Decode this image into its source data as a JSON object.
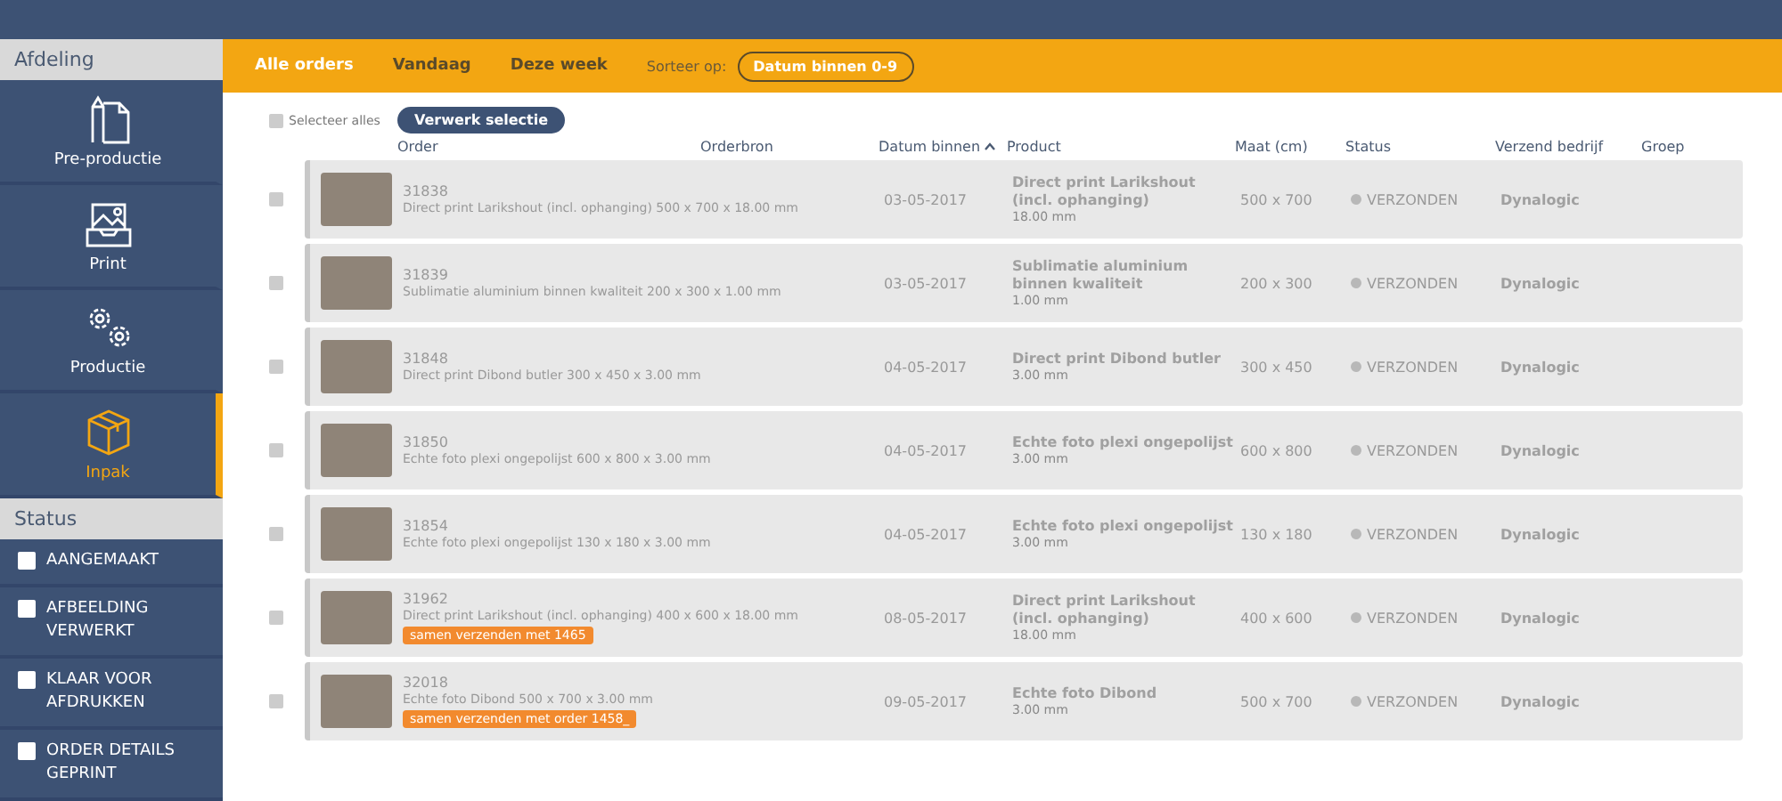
{
  "sidebar": {
    "department_heading": "Afdeling",
    "departments": [
      {
        "label": "Pre-productie",
        "kind": "document",
        "selected": false
      },
      {
        "label": "Print",
        "kind": "image",
        "selected": false
      },
      {
        "label": "Productie",
        "kind": "gears",
        "selected": false
      },
      {
        "label": "Inpak",
        "kind": "box",
        "selected": true
      }
    ],
    "status_heading": "Status",
    "statuses": [
      {
        "label": "AANGEMAAKT",
        "checked": false
      },
      {
        "label": "AFBEELDING VERWERKT",
        "checked": false
      },
      {
        "label": "KLAAR VOOR AFDRUKKEN",
        "checked": false
      },
      {
        "label": "ORDER DETAILS GEPRINT",
        "checked": false
      }
    ]
  },
  "filters": [
    {
      "label": "Alle orders",
      "selected": true
    },
    {
      "label": "Vandaag",
      "selected": false
    },
    {
      "label": "Deze week",
      "selected": false
    }
  ],
  "sort": {
    "label": "Sorteer op:",
    "value": "Datum binnen 0-9"
  },
  "toolbar": {
    "select_all": {
      "label": "Selecteer alles",
      "checked": false
    },
    "process_button": "Verwerk selectie"
  },
  "columns": [
    {
      "label": "Order",
      "sorted": false
    },
    {
      "label": "Orderbron",
      "sorted": false
    },
    {
      "label": "Datum binnen",
      "sorted": true
    },
    {
      "label": "Product",
      "sorted": false
    },
    {
      "label": "Maat (cm)",
      "sorted": false
    },
    {
      "label": "Status",
      "sorted": false
    },
    {
      "label": "Verzend bedrijf",
      "sorted": false
    },
    {
      "label": "Groep",
      "sorted": false
    }
  ],
  "rows": [
    {
      "checked": false,
      "order": "31838",
      "description": "Direct print Larikshout (incl. ophanging) 500 x 700 x 18.00 mm",
      "date": "03-05-2017",
      "product": "Direct print Larikshout (incl. ophanging)",
      "thickness": "18.00 mm",
      "size": "500 x 700",
      "status": "VERZONDEN",
      "carrier": "Dynalogic"
    },
    {
      "checked": false,
      "order": "31839",
      "description": "Sublimatie aluminium binnen kwaliteit 200 x 300 x 1.00 mm",
      "date": "03-05-2017",
      "product": "Sublimatie aluminium binnen kwaliteit",
      "thickness": "1.00 mm",
      "size": "200 x 300",
      "status": "VERZONDEN",
      "carrier": "Dynalogic"
    },
    {
      "checked": false,
      "order": "31848",
      "description": "Direct print Dibond butler 300 x 450 x 3.00 mm",
      "date": "04-05-2017",
      "product": "Direct print Dibond butler",
      "thickness": "3.00 mm",
      "size": "300 x 450",
      "status": "VERZONDEN",
      "carrier": "Dynalogic"
    },
    {
      "checked": false,
      "order": "31850",
      "description": "Echte foto plexi ongepolijst 600 x 800 x 3.00 mm",
      "date": "04-05-2017",
      "product": "Echte foto plexi ongepolijst",
      "thickness": "3.00 mm",
      "size": "600 x 800",
      "status": "VERZONDEN",
      "carrier": "Dynalogic"
    },
    {
      "checked": false,
      "order": "31854",
      "description": "Echte foto plexi ongepolijst 130 x 180 x 3.00 mm",
      "date": "04-05-2017",
      "product": "Echte foto plexi ongepolijst",
      "thickness": "3.00 mm",
      "size": "130 x 180",
      "status": "VERZONDEN",
      "carrier": "Dynalogic"
    },
    {
      "checked": false,
      "order": "31962",
      "description": "Direct print Larikshout (incl. ophanging) 400 x 600 x 18.00 mm",
      "tag": "samen verzenden met 1465",
      "date": "08-05-2017",
      "product": "Direct print Larikshout (incl. ophanging)",
      "thickness": "18.00 mm",
      "size": "400 x 600",
      "status": "VERZONDEN",
      "carrier": "Dynalogic"
    },
    {
      "checked": false,
      "order": "32018",
      "description": "Echte foto Dibond 500 x 700 x 3.00 mm",
      "tag": "samen verzenden met order 1458_",
      "date": "09-05-2017",
      "product": "Echte foto Dibond",
      "thickness": "3.00 mm",
      "size": "500 x 700",
      "status": "VERZONDEN",
      "carrier": "Dynalogic"
    }
  ]
}
